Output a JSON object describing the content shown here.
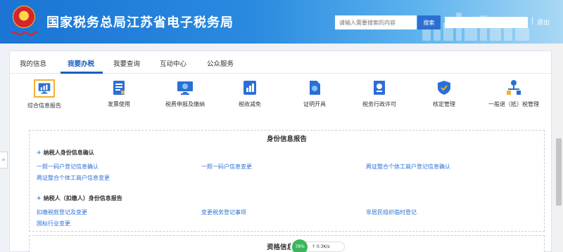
{
  "header": {
    "title": "国家税务总局江苏省电子税务局",
    "search_placeholder": "请输入需要搜索的内容",
    "search_button": "搜索",
    "separator": "|",
    "logout": "退出"
  },
  "tabs": [
    {
      "label": "我的信息",
      "active": false
    },
    {
      "label": "我要办税",
      "active": true
    },
    {
      "label": "我要查询",
      "active": false
    },
    {
      "label": "互动中心",
      "active": false
    },
    {
      "label": "公众服务",
      "active": false
    }
  ],
  "categories": [
    {
      "label": "综合信息报告",
      "icon": "monitor-chart-icon",
      "active": true
    },
    {
      "label": "发票使用",
      "icon": "invoice-document-icon"
    },
    {
      "label": "税费申报及缴纳",
      "icon": "monitor-declare-icon"
    },
    {
      "label": "税收减免",
      "icon": "tax-reduction-chart-icon"
    },
    {
      "label": "证明开具",
      "icon": "certificate-document-icon"
    },
    {
      "label": "税务行政许可",
      "icon": "admin-license-icon"
    },
    {
      "label": "核定管理",
      "icon": "shield-check-icon"
    },
    {
      "label": "一般退（抵）税管理",
      "icon": "network-nodes-icon"
    }
  ],
  "report": {
    "section_title": "身份信息报告",
    "group1": {
      "title": "纳税人身份信息确认",
      "links": [
        "一照一码户登记信息确认",
        "一照一码户信息变更",
        "两证整合个体工商户登记信息确认",
        "两证整合个体工商户信息变更"
      ]
    },
    "group2": {
      "title": "纳税人（扣缴人）身份信息报告",
      "links": [
        "扣缴税款登记及变更",
        "变更税务登记事项",
        "非居民组织临时登记",
        "国标行业变更"
      ]
    },
    "next_section_title": "资格信息报告"
  },
  "side_toggle": "»",
  "float_widget": {
    "badge": "78%",
    "text": "↑ 0.3K/s"
  },
  "colors": {
    "header_blue": "#1b74d3",
    "link_blue": "#2b6fd6",
    "active_tab": "#1a5cc0",
    "highlight_border": "#f2b035"
  }
}
